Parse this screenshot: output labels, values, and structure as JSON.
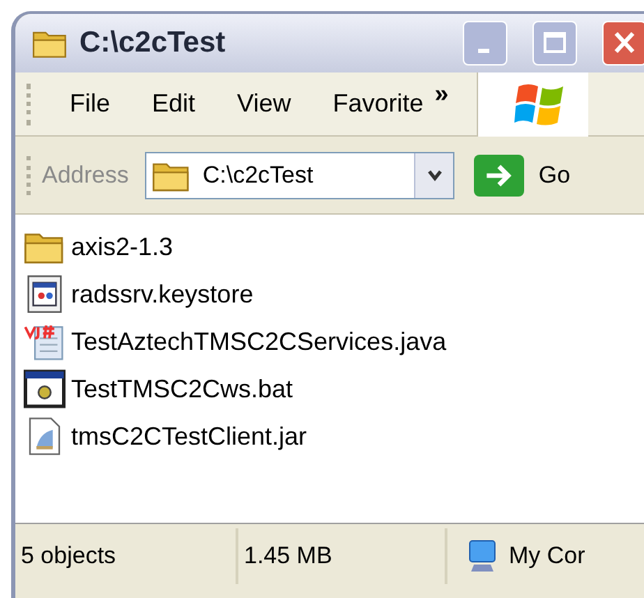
{
  "window": {
    "title": "C:\\c2cTest"
  },
  "menu": [
    {
      "label": "File"
    },
    {
      "label": "Edit"
    },
    {
      "label": "View"
    },
    {
      "label": "Favorite"
    }
  ],
  "menu_overflow": "»",
  "address": {
    "label": "Address",
    "value": "C:\\c2cTest"
  },
  "go_button": {
    "label": "Go"
  },
  "files": [
    {
      "name": "axis2-1.3",
      "kind": "folder"
    },
    {
      "name": "radssrv.keystore",
      "kind": "keystore"
    },
    {
      "name": "TestAztechTMSC2CServices.java",
      "kind": "java"
    },
    {
      "name": "TestTMSC2Cws.bat",
      "kind": "bat"
    },
    {
      "name": "tmsC2CTestClient.jar",
      "kind": "jar"
    }
  ],
  "status_bar": [
    {
      "text": "5 objects",
      "kind": "count"
    },
    {
      "text": "1.45 MB",
      "kind": "size"
    },
    {
      "text": "My Cor",
      "kind": "zone"
    }
  ]
}
